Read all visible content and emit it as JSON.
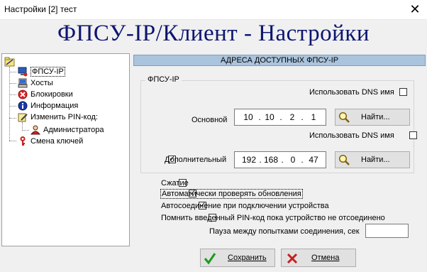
{
  "window": {
    "title": "Настройки [2] тест",
    "close_symbol": "✕"
  },
  "banner": {
    "title": "ФПСУ-IP/Клиент - Настройки",
    "color": "#0c1570"
  },
  "tree": {
    "items": [
      {
        "label": "ФПСУ-IP",
        "icon": "computer-icon"
      },
      {
        "label": "Хосты",
        "icon": "hosts-icon"
      },
      {
        "label": "Блокировки",
        "icon": "block-icon"
      },
      {
        "label": "Информация",
        "icon": "info-icon"
      },
      {
        "label": "Изменить PIN-код:",
        "icon": "edit-pin-icon"
      },
      {
        "label": "Администратора",
        "icon": "admin-user-icon"
      },
      {
        "label": "Смена ключей",
        "icon": "key-icon"
      }
    ]
  },
  "section": {
    "header": "АДРЕСА ДОСТУПНЫХ ФПСУ-IP"
  },
  "group": {
    "legend": "ФПСУ-IP",
    "use_dns_label": "Использовать DNS имя",
    "primary": {
      "label": "Основной",
      "ip": [
        "10",
        "10",
        "2",
        "1"
      ],
      "use_dns_checked": false
    },
    "secondary": {
      "label": "Дополнительный",
      "ip": [
        "192",
        "168",
        "0",
        "47"
      ],
      "enabled_checked": true,
      "use_dns_checked": false
    },
    "find_label": "Найти...",
    "dot": "."
  },
  "options": {
    "compression": {
      "label": "Сжатие",
      "checked": false
    },
    "auto_update": {
      "label": "Автоматически проверять обновления",
      "checked": true
    },
    "auto_connect": {
      "label": "Автосоединение при подключении устройства",
      "checked": true
    },
    "remember_pin": {
      "label": "Помнить введенный PIN-код пока устройство не отсоединено",
      "checked": false
    },
    "pause_label": "Пауза между попытками соединения, сек",
    "pause_value": ""
  },
  "buttons": {
    "save": "Сохранить",
    "cancel": "Отмена"
  },
  "colors": {
    "header_bg": "#aac4dd",
    "save_check": "#1a9c1a",
    "cancel_x": "#c81e1e"
  }
}
